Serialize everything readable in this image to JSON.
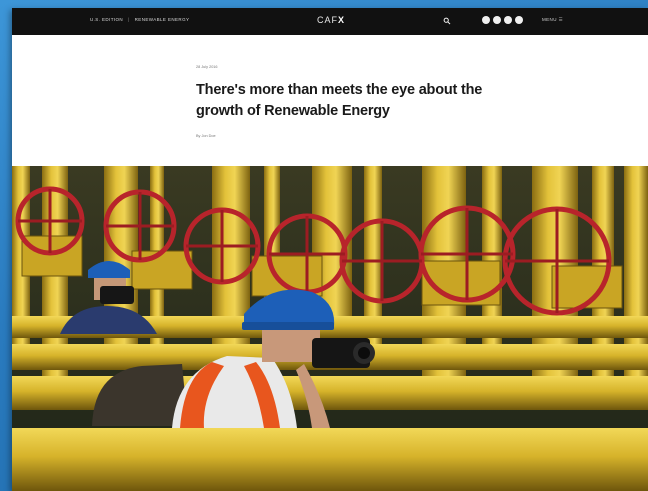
{
  "topbar": {
    "edition": "U.S. Edition",
    "section": "Renewable Energy",
    "logo_main": "CAF",
    "logo_accent": "X",
    "menu_label": "Menu",
    "social_icons": [
      "facebook-icon",
      "twitter-icon",
      "instagram-icon",
      "email-icon"
    ]
  },
  "article": {
    "date": "28 July 2016",
    "headline": "There's more than meets the eye about the growth of Renewable Energy",
    "byline": "By Jon Doe"
  },
  "colors": {
    "topbar": "#111111",
    "pipe_yellow": "#d9b52a",
    "valve_red": "#b8242b",
    "helmet_blue": "#1d5fb8",
    "vest_orange": "#e8561e"
  }
}
